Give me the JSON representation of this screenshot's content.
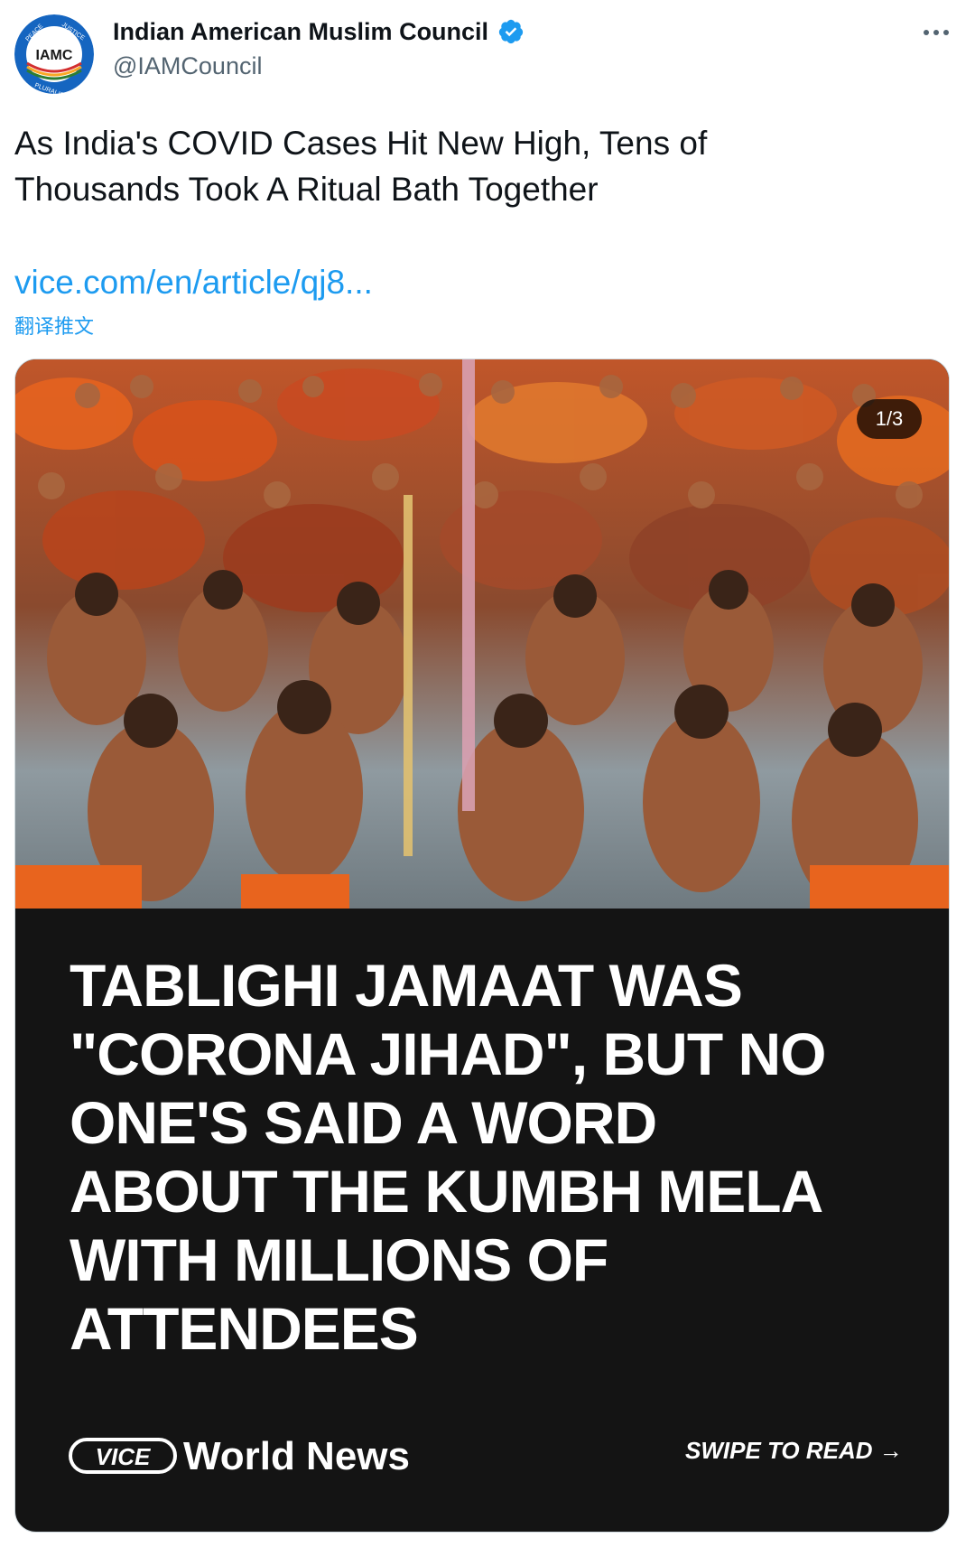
{
  "account": {
    "display_name": "Indian American Muslim Council",
    "handle": "@IAMCouncil",
    "verified": true,
    "avatar": {
      "center_text": "IAMC",
      "ring_text": [
        "PEACE",
        "JUSTICE",
        "PLURALISM"
      ],
      "ring_color": "#1565c0"
    }
  },
  "actions": {
    "more_icon": "more-horizontal-icon"
  },
  "tweet": {
    "text_lines": [
      "As India's COVID Cases Hit New High, Tens of",
      "Thousands Took A Ritual Bath Together"
    ],
    "link": "vice.com/en/article/qj8...",
    "translate_label": "翻译推文"
  },
  "media": {
    "counter": "1/3",
    "headline_lines": [
      "TABLIGHI JAMAAT WAS",
      "\"CORONA JIHAD\", BUT NO",
      "ONE'S SAID A WORD",
      "ABOUT THE KUMBH MELA",
      "WITH MILLIONS OF",
      "ATTENDEES"
    ],
    "brand_logo_text": "VICE",
    "brand_section": "World News",
    "swipe_label": "SWIPE TO READ →"
  },
  "colors": {
    "link": "#1d9bf0",
    "handle": "#536471",
    "card_background": "#141414",
    "verified": "#1d9bf0"
  }
}
